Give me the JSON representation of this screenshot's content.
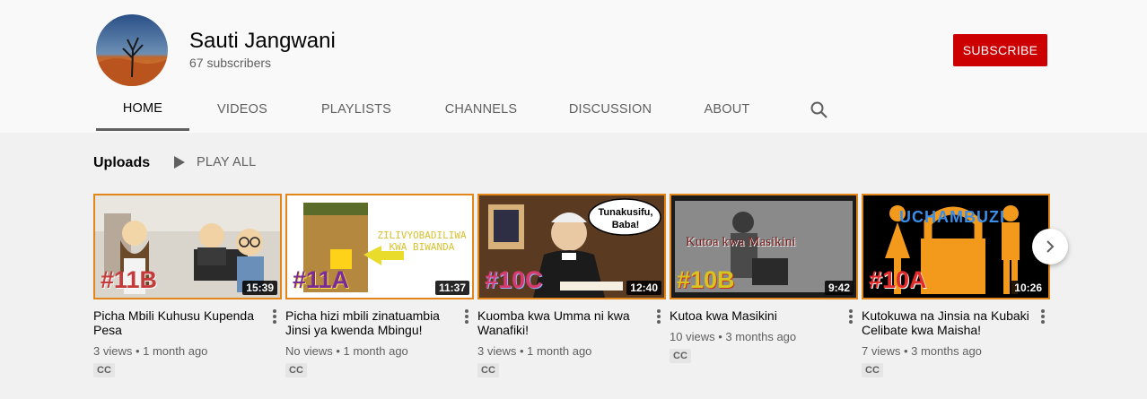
{
  "channel": {
    "name": "Sauti Jangwani",
    "subscribers": "67 subscribers",
    "subscribe_label": "SUBSCRIBE"
  },
  "tabs": [
    "HOME",
    "VIDEOS",
    "PLAYLISTS",
    "CHANNELS",
    "DISCUSSION",
    "ABOUT"
  ],
  "active_tab": "HOME",
  "section": {
    "title": "Uploads",
    "play_all_label": "PLAY ALL"
  },
  "videos": [
    {
      "title": "Picha Mbili Kuhusu Kupenda Pesa",
      "duration": "15:39",
      "meta": "3 views • 1 month ago",
      "cc": "CC",
      "thumb_tag": "#11B",
      "thumb_caption": ""
    },
    {
      "title": "Picha hizi mbili zinatuambia Jinsi ya kwenda Mbingu!",
      "duration": "11:37",
      "meta": "No views • 1 month ago",
      "cc": "CC",
      "thumb_tag": "#11A",
      "thumb_caption": "ZILIVYOBADILIWA KWA BIWANDA"
    },
    {
      "title": "Kuomba kwa Umma ni kwa Wanafiki!",
      "duration": "12:40",
      "meta": "3 views • 1 month ago",
      "cc": "CC",
      "thumb_tag": "#10C",
      "thumb_caption": "Tunakusifu, Baba!"
    },
    {
      "title": "Kutoa kwa Masikini",
      "duration": "9:42",
      "meta": "10 views • 3 months ago",
      "cc": "CC",
      "thumb_tag": "#10B",
      "thumb_caption": "Kutoa kwa Masikini"
    },
    {
      "title": "Kutokuwa na Jinsia na Kubaki Celibate kwa Maisha!",
      "duration": "10:26",
      "meta": "7 views • 3 months ago",
      "cc": "CC",
      "thumb_tag": "#10A",
      "thumb_caption": "UCHAMBUZI"
    }
  ],
  "colors": {
    "subscribe_bg": "#cc0000",
    "thumb_border": "#e3861a",
    "page_bg": "#f1f1f1",
    "header_bg": "#f9f9f9"
  }
}
